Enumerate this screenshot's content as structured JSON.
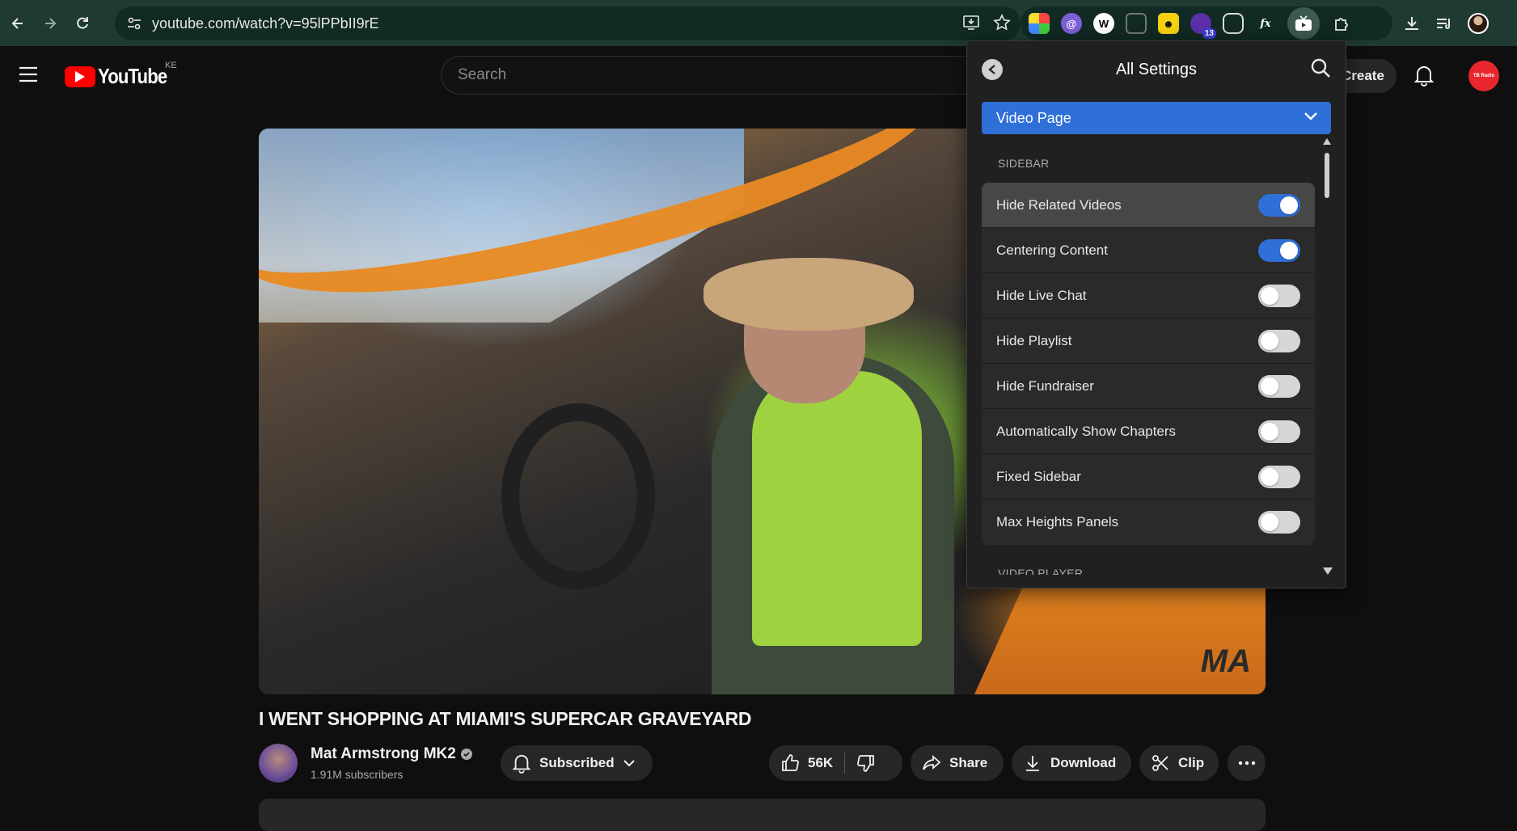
{
  "browser": {
    "url": "youtube.com/watch?v=95lPPbII9rE",
    "extension_badge": "13"
  },
  "youtube": {
    "logo_text": "YouTube",
    "country_code": "KE",
    "search_placeholder": "Search",
    "create_label": "Create",
    "avatar_text": "TB Radio",
    "video": {
      "title": "I WENT SHOPPING AT MIAMI'S SUPERCAR GRAVEYARD",
      "watermark": "MA",
      "channel_name": "Mat Armstrong MK2",
      "subscribers": "1.91M subscribers",
      "subscribed_label": "Subscribed",
      "likes": "56K",
      "share_label": "Share",
      "download_label": "Download",
      "clip_label": "Clip"
    }
  },
  "settings_popup": {
    "title": "All Settings",
    "dropdown_value": "Video Page",
    "section1": "SIDEBAR",
    "section2": "VIDEO PLAYER",
    "items": [
      {
        "label": "Hide Related Videos",
        "on": true
      },
      {
        "label": "Centering Content",
        "on": true
      },
      {
        "label": "Hide Live Chat",
        "on": false
      },
      {
        "label": "Hide Playlist",
        "on": false
      },
      {
        "label": "Hide Fundraiser",
        "on": false
      },
      {
        "label": "Automatically Show Chapters",
        "on": false
      },
      {
        "label": "Fixed Sidebar",
        "on": false
      },
      {
        "label": "Max Heights Panels",
        "on": false
      }
    ]
  },
  "colors": {
    "accent_blue": "#2f6fd8",
    "chrome_bg": "#1f3a33",
    "yt_red": "#ff0000"
  }
}
